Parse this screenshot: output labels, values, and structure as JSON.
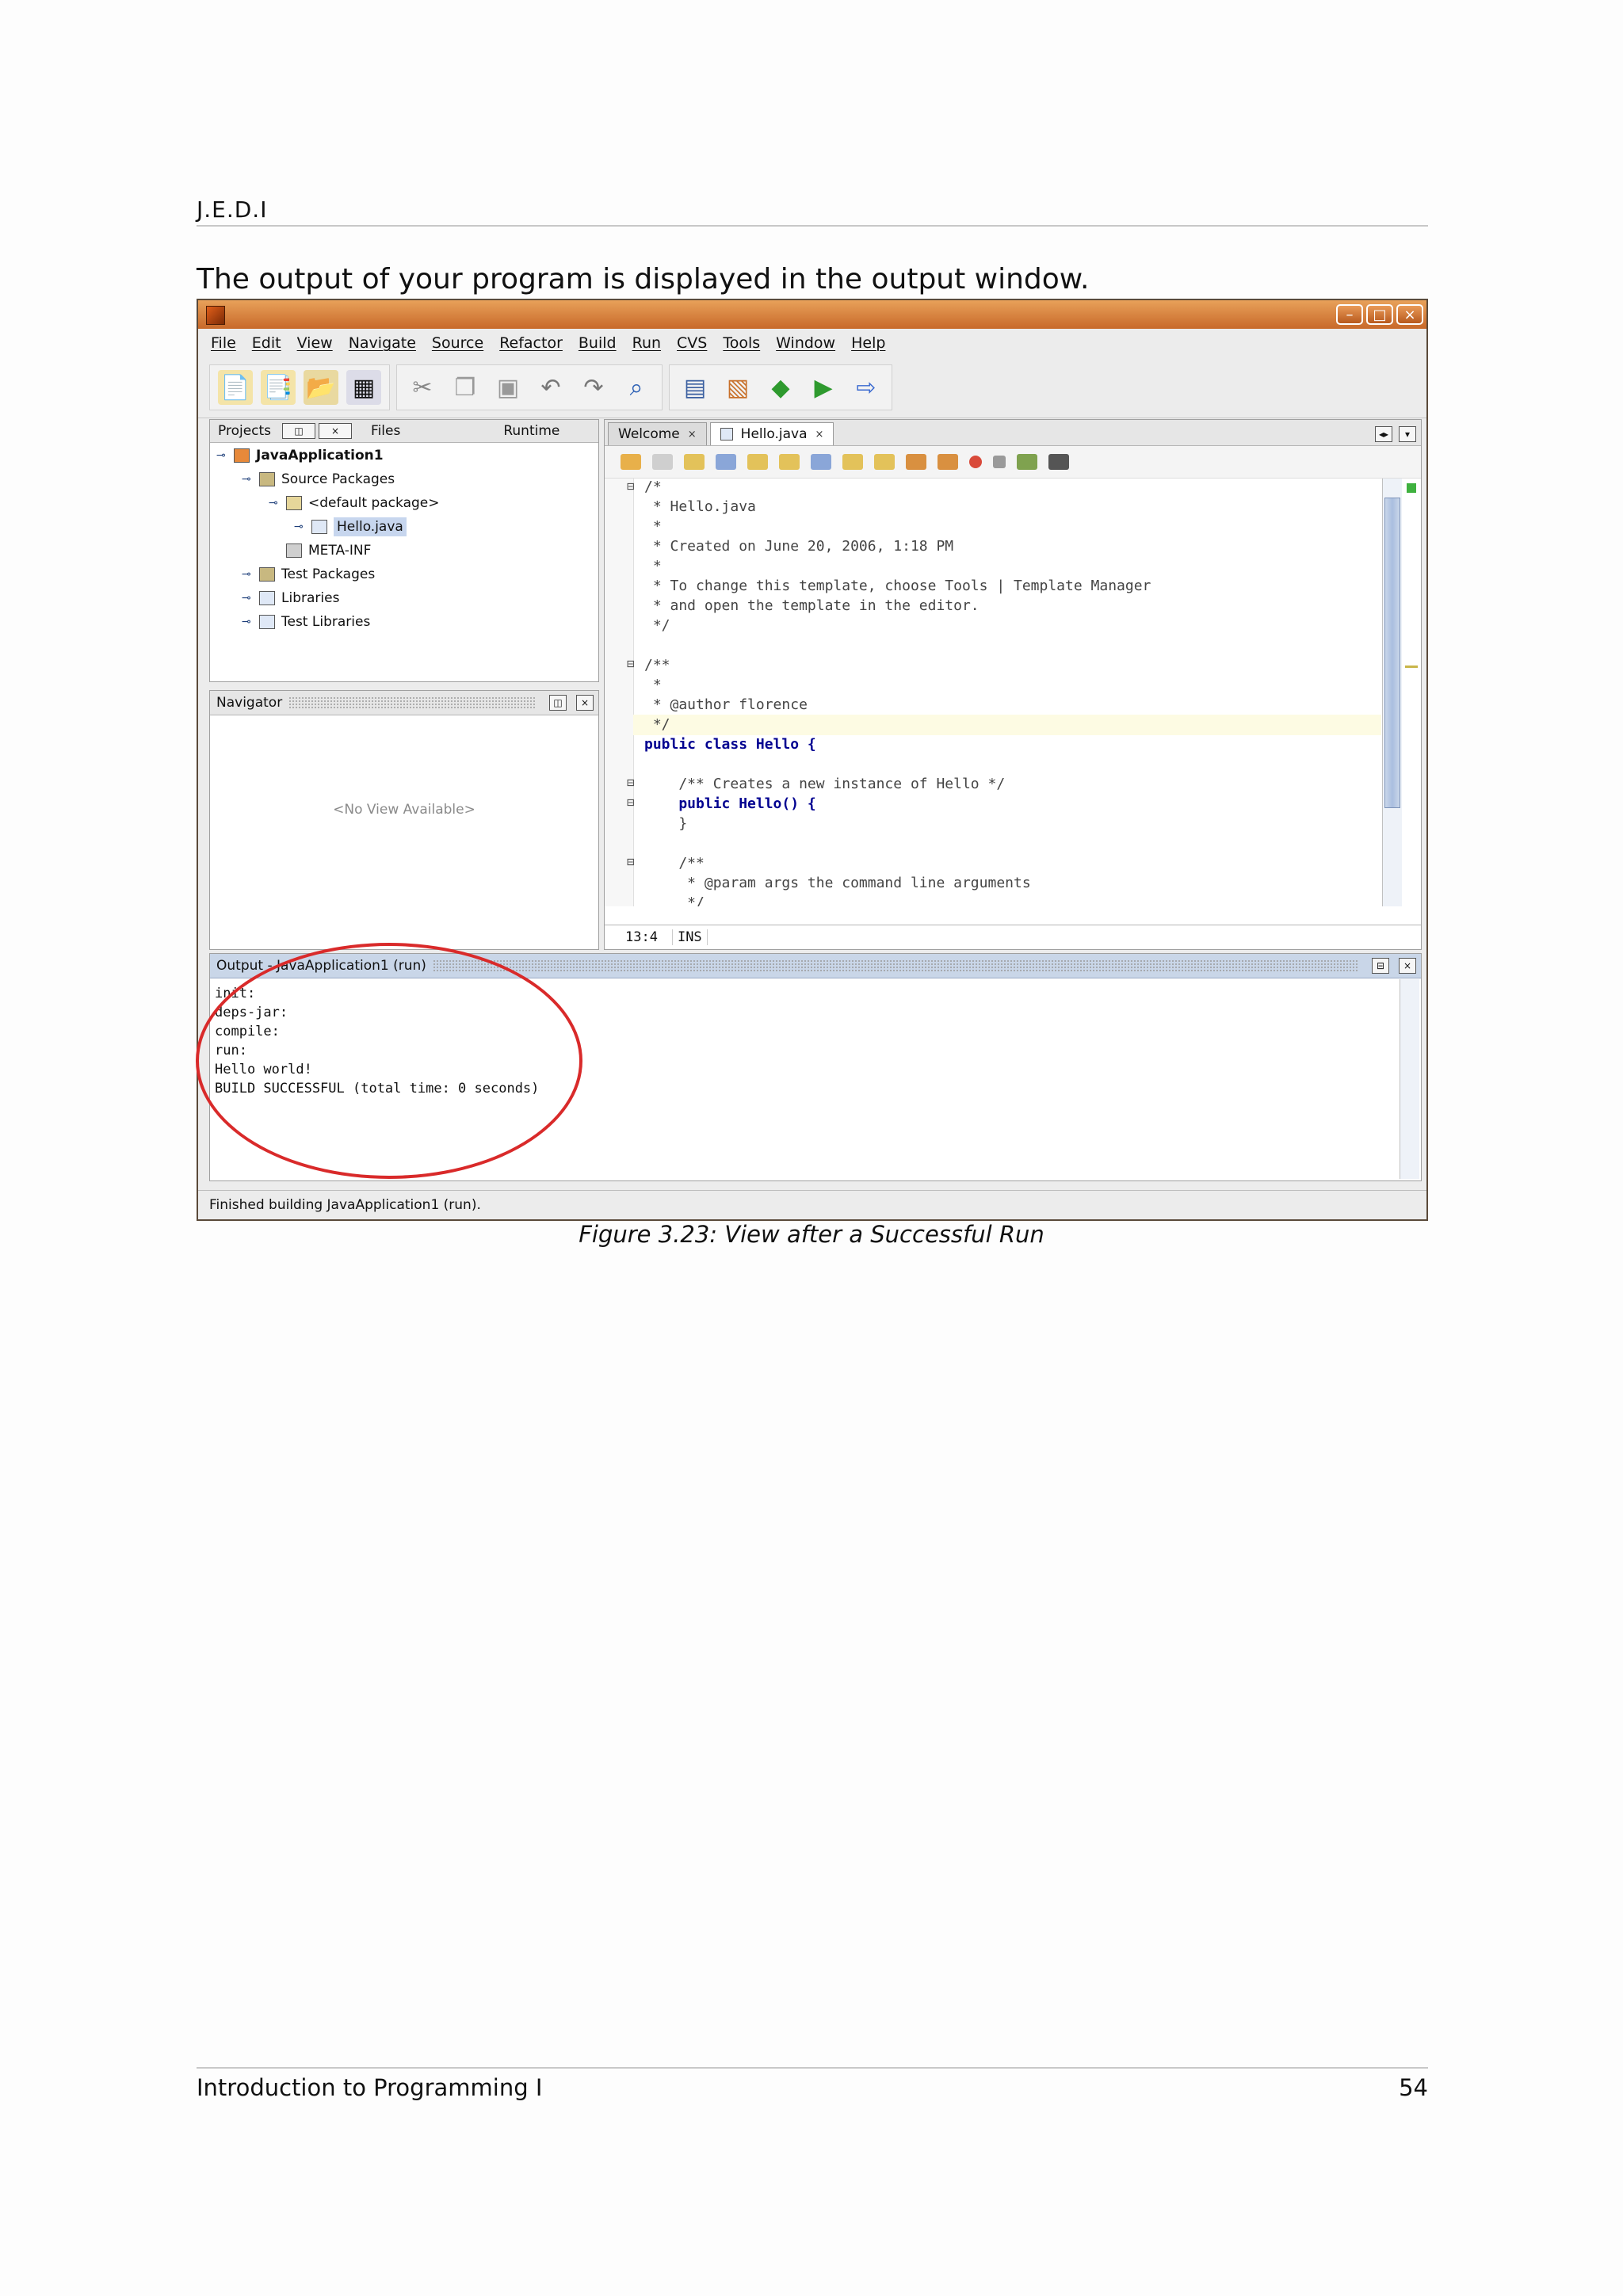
{
  "header": {
    "text": "J.E.D.I"
  },
  "intro": "The output of your program is displayed in the output window.",
  "ide": {
    "menu": [
      "File",
      "Edit",
      "View",
      "Navigate",
      "Source",
      "Refactor",
      "Build",
      "Run",
      "CVS",
      "Tools",
      "Window",
      "Help"
    ],
    "projects_tabs": [
      "Projects",
      "Files",
      "Runtime"
    ],
    "tree": [
      {
        "label": "JavaApplication1"
      },
      {
        "label": "Source Packages"
      },
      {
        "label": "<default package>"
      },
      {
        "label": "Hello.java"
      },
      {
        "label": "META-INF"
      },
      {
        "label": "Test Packages"
      },
      {
        "label": "Libraries"
      },
      {
        "label": "Test Libraries"
      }
    ],
    "navigator": {
      "title": "Navigator",
      "empty": "<No View Available>"
    },
    "editor": {
      "tabs": [
        "Welcome",
        "Hello.java"
      ],
      "code": [
        "/*",
        " * Hello.java",
        " *",
        " * Created on June 20, 2006, 1:18 PM",
        " *",
        " * To change this template, choose Tools | Template Manager",
        " * and open the template in the editor.",
        " */",
        "",
        "/**",
        " *",
        " * @author florence",
        " */",
        "public class Hello {",
        "",
        "    /** Creates a new instance of Hello */",
        "    public Hello() {",
        "    }",
        "",
        "    /**",
        "     * @param args the command line arguments",
        "     */"
      ],
      "position": "13:4",
      "mode": "INS"
    },
    "output": {
      "title": "Output - JavaApplication1 (run)",
      "lines": [
        "init:",
        "deps-jar:",
        "compile:",
        "run:",
        "Hello world!",
        "BUILD SUCCESSFUL (total time: 0 seconds)"
      ]
    },
    "status": "Finished building JavaApplication1 (run)."
  },
  "caption": "Figure 3.23: View after a Successful Run",
  "footer": {
    "left": "Introduction to Programming I",
    "page": "54"
  }
}
